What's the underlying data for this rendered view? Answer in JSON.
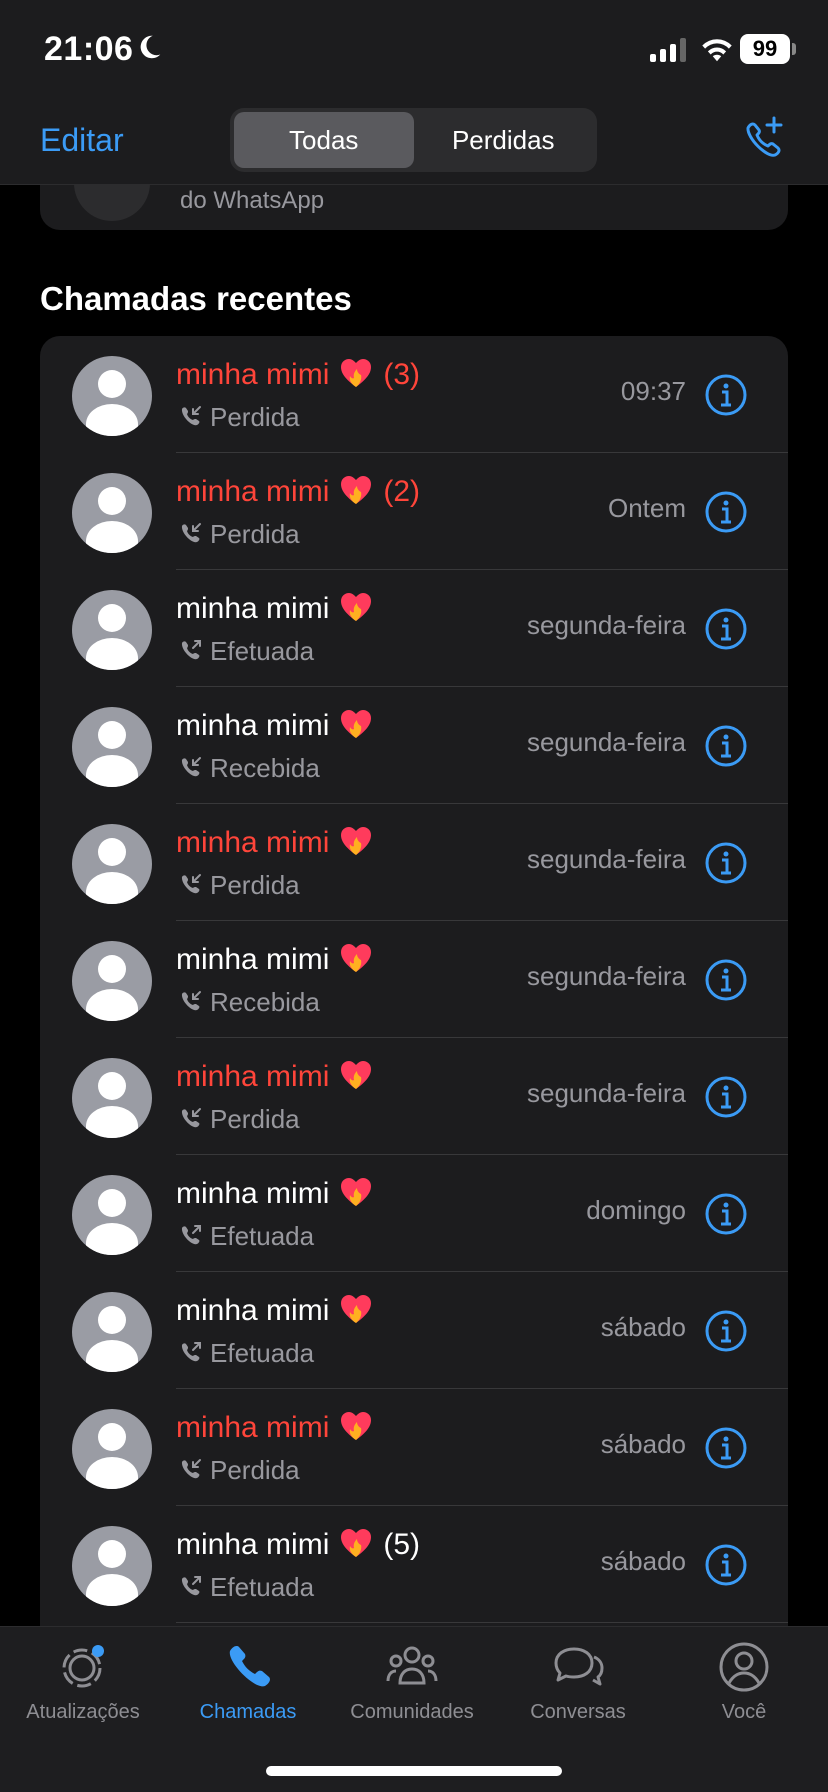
{
  "status_bar": {
    "time": "21:06",
    "battery": "99"
  },
  "nav": {
    "edit_label": "Editar",
    "segments": [
      "Todas",
      "Perdidas"
    ],
    "selected_segment": "Todas"
  },
  "top_card": {
    "text": "do WhatsApp"
  },
  "section_title": "Chamadas recentes",
  "calls": [
    {
      "name": "minha mimi",
      "count": "(3)",
      "type": "Perdida",
      "when": "09:37",
      "missed": true
    },
    {
      "name": "minha mimi",
      "count": "(2)",
      "type": "Perdida",
      "when": "Ontem",
      "missed": true
    },
    {
      "name": "minha mimi",
      "count": "",
      "type": "Efetuada",
      "when": "segunda-feira",
      "missed": false
    },
    {
      "name": "minha mimi",
      "count": "",
      "type": "Recebida",
      "when": "segunda-feira",
      "missed": false
    },
    {
      "name": "minha mimi",
      "count": "",
      "type": "Perdida",
      "when": "segunda-feira",
      "missed": true
    },
    {
      "name": "minha mimi",
      "count": "",
      "type": "Recebida",
      "when": "segunda-feira",
      "missed": false
    },
    {
      "name": "minha mimi",
      "count": "",
      "type": "Perdida",
      "when": "segunda-feira",
      "missed": true
    },
    {
      "name": "minha mimi",
      "count": "",
      "type": "Efetuada",
      "when": "domingo",
      "missed": false
    },
    {
      "name": "minha mimi",
      "count": "",
      "type": "Efetuada",
      "when": "sábado",
      "missed": false
    },
    {
      "name": "minha mimi",
      "count": "",
      "type": "Perdida",
      "when": "sábado",
      "missed": true
    },
    {
      "name": "minha mimi",
      "count": "(5)",
      "type": "Efetuada",
      "when": "sábado",
      "missed": false
    }
  ],
  "tabs": [
    {
      "label": "Atualizações",
      "icon": "updates-icon"
    },
    {
      "label": "Chamadas",
      "icon": "phone-icon",
      "active": true
    },
    {
      "label": "Comunidades",
      "icon": "communities-icon"
    },
    {
      "label": "Conversas",
      "icon": "chats-icon"
    },
    {
      "label": "Você",
      "icon": "profile-icon"
    }
  ],
  "colors": {
    "accent": "#3b9bf5",
    "missed": "#ff453a",
    "secondary_text": "#98989e"
  },
  "emoji": "heart-on-fire"
}
